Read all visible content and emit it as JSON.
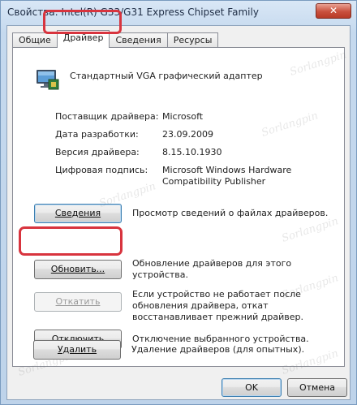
{
  "window": {
    "title": "Свойства: Intel(R) G33/G31 Express Chipset Family",
    "close_label": "✕"
  },
  "tabs": [
    {
      "label": "Общие",
      "active": false
    },
    {
      "label": "Драйвер",
      "active": true
    },
    {
      "label": "Сведения",
      "active": false
    },
    {
      "label": "Ресурсы",
      "active": false
    }
  ],
  "device": {
    "name": "Стандартный VGA графический адаптер",
    "icon": "display-adapter-icon"
  },
  "properties": [
    {
      "label": "Поставщик драйвера:",
      "value": "Microsoft"
    },
    {
      "label": "Дата разработки:",
      "value": "23.09.2009"
    },
    {
      "label": "Версия драйвера:",
      "value": "8.15.10.1930"
    },
    {
      "label": "Цифровая подпись:",
      "value": "Microsoft Windows Hardware Compatibility Publisher"
    }
  ],
  "actions": [
    {
      "button": "Сведения",
      "description": "Просмотр сведений о файлах драйверов.",
      "enabled": true
    },
    {
      "button": "Обновить...",
      "description": "Обновление драйверов для этого устройства.",
      "enabled": true
    },
    {
      "button": "Откатить",
      "description": "Если устройство не работает после обновления драйвера, откат восстанавливает прежний драйвер.",
      "enabled": false
    },
    {
      "button": "Отключить",
      "description": "Отключение выбранного устройства.",
      "enabled": true
    },
    {
      "button": "Удалить",
      "description": "Удаление драйверов (для опытных).",
      "enabled": true
    }
  ],
  "footer": {
    "ok_label": "OK",
    "cancel_label": "Отмена"
  },
  "watermark": "Sorlangpin",
  "colors": {
    "highlight": "#d8343e",
    "accent": "#3c7fb1"
  }
}
